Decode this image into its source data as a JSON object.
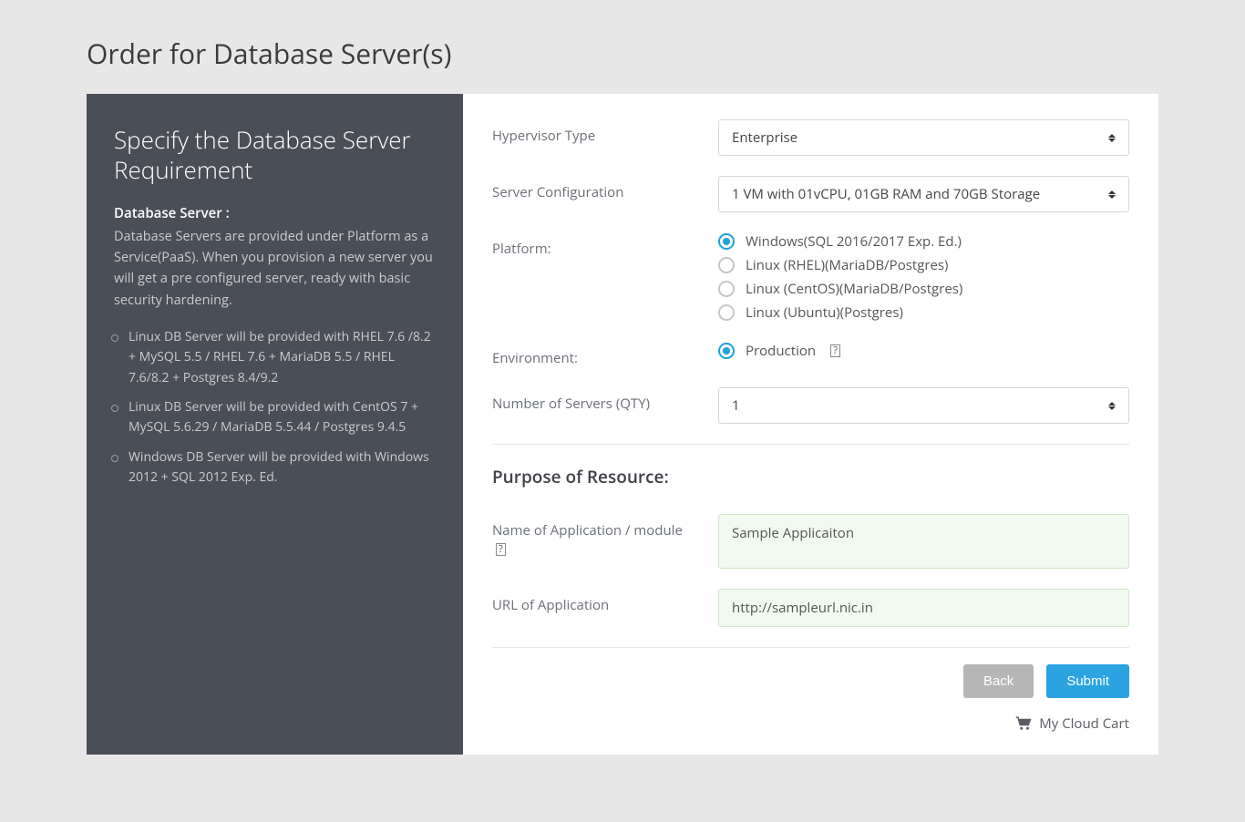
{
  "page_title": "Order for Database Server(s)",
  "sidebar": {
    "heading": "Specify the Database Server Requirement",
    "lead_label": "Database Server :",
    "lead_text": "Database Servers are provided under Platform as a Service(PaaS). When you provision a new server you will get a pre configured server, ready with basic security hardening.",
    "bullets": [
      "Linux DB Server will be provided with RHEL 7.6 /8.2 + MySQL 5.5 / RHEL 7.6 + MariaDB 5.5 / RHEL 7.6/8.2 + Postgres 8.4/9.2",
      "Linux DB Server will be provided with CentOS 7 + MySQL 5.6.29 / MariaDB 5.5.44 / Postgres 9.4.5",
      "Windows DB Server will be provided with Windows 2012 + SQL 2012 Exp. Ed."
    ]
  },
  "form": {
    "hypervisor": {
      "label": "Hypervisor Type",
      "value": "Enterprise"
    },
    "server_config": {
      "label": "Server Configuration",
      "value": "1 VM with 01vCPU, 01GB RAM and 70GB Storage"
    },
    "platform": {
      "label": "Platform:",
      "options": [
        "Windows(SQL 2016/2017 Exp. Ed.)",
        "Linux (RHEL)(MariaDB/Postgres)",
        "Linux (CentOS)(MariaDB/Postgres)",
        "Linux (Ubuntu)(Postgres)"
      ],
      "selected_index": 0
    },
    "environment": {
      "label": "Environment:",
      "value": "Production",
      "help": "?"
    },
    "qty": {
      "label": "Number of Servers (QTY)",
      "value": "1"
    },
    "purpose_heading": "Purpose of Resource:",
    "app_name": {
      "label": "Name of Application / module",
      "help": "?",
      "value": "Sample Applicaiton"
    },
    "app_url": {
      "label": "URL of Application",
      "value": "http://sampleurl.nic.in"
    }
  },
  "buttons": {
    "back": "Back",
    "submit": "Submit"
  },
  "cart_label": "My Cloud Cart"
}
